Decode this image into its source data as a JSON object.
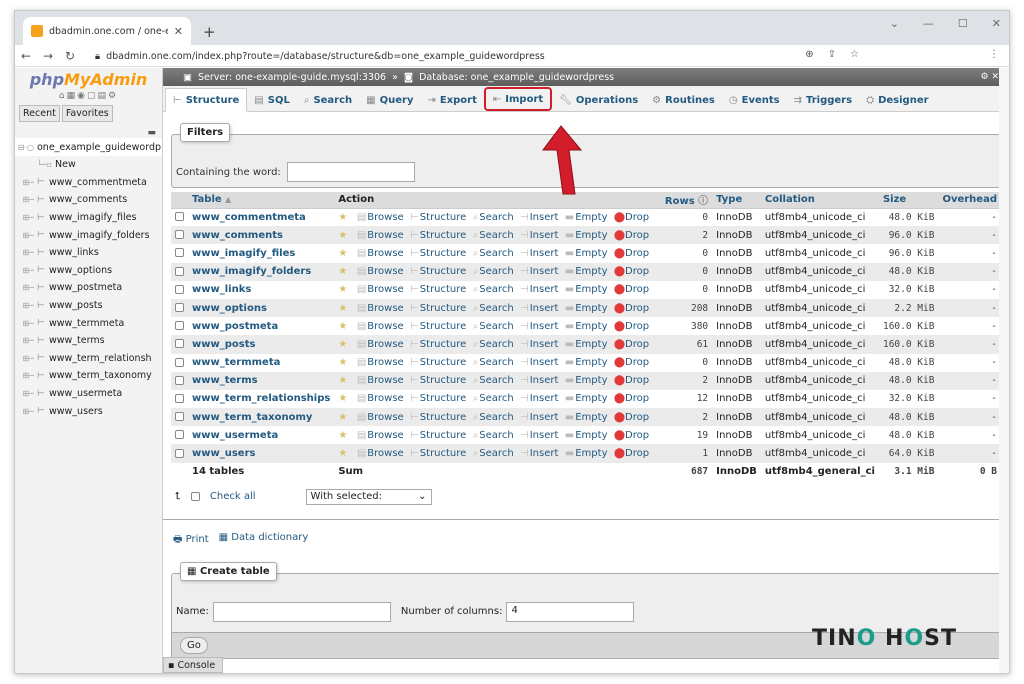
{
  "browser": {
    "tab_title": "dbadmin.one.com / one-exampl",
    "url": "dbadmin.one.com/index.php?route=/database/structure&db=one_example_guidewordpress"
  },
  "logo": {
    "a": "php",
    "b": "MyAdmin"
  },
  "nav": {
    "recent": "Recent",
    "favorites": "Favorites",
    "db": "one_example_guidewordp",
    "new": "New",
    "tables": [
      "www_commentmeta",
      "www_comments",
      "www_imagify_files",
      "www_imagify_folders",
      "www_links",
      "www_options",
      "www_postmeta",
      "www_posts",
      "www_termmeta",
      "www_terms",
      "www_term_relationsh",
      "www_term_taxonomy",
      "www_usermeta",
      "www_users"
    ]
  },
  "breadcrumb": {
    "server": "Server: one-example-guide.mysql:3306",
    "sep": "»",
    "database": "Database: one_example_guidewordpress"
  },
  "menu": [
    "Structure",
    "SQL",
    "Search",
    "Query",
    "Export",
    "Import",
    "Operations",
    "Routines",
    "Events",
    "Triggers",
    "Designer"
  ],
  "filters": {
    "legend": "Filters",
    "label": "Containing the word:"
  },
  "table": {
    "headers": {
      "table": "Table",
      "action": "Action",
      "rows": "Rows",
      "type": "Type",
      "collation": "Collation",
      "size": "Size",
      "overhead": "Overhead"
    },
    "actions": {
      "browse": "Browse",
      "structure": "Structure",
      "search": "Search",
      "insert": "Insert",
      "empty": "Empty",
      "drop": "Drop"
    },
    "rows": [
      {
        "name": "www_commentmeta",
        "rows": "0",
        "type": "InnoDB",
        "coll": "utf8mb4_unicode_ci",
        "size": "48.0 KiB",
        "over": "-"
      },
      {
        "name": "www_comments",
        "rows": "2",
        "type": "InnoDB",
        "coll": "utf8mb4_unicode_ci",
        "size": "96.0 KiB",
        "over": "-"
      },
      {
        "name": "www_imagify_files",
        "rows": "0",
        "type": "InnoDB",
        "coll": "utf8mb4_unicode_ci",
        "size": "96.0 KiB",
        "over": "-"
      },
      {
        "name": "www_imagify_folders",
        "rows": "0",
        "type": "InnoDB",
        "coll": "utf8mb4_unicode_ci",
        "size": "48.0 KiB",
        "over": "-"
      },
      {
        "name": "www_links",
        "rows": "0",
        "type": "InnoDB",
        "coll": "utf8mb4_unicode_ci",
        "size": "32.0 KiB",
        "over": "-"
      },
      {
        "name": "www_options",
        "rows": "208",
        "type": "InnoDB",
        "coll": "utf8mb4_unicode_ci",
        "size": "2.2 MiB",
        "over": "-"
      },
      {
        "name": "www_postmeta",
        "rows": "380",
        "type": "InnoDB",
        "coll": "utf8mb4_unicode_ci",
        "size": "160.0 KiB",
        "over": "-"
      },
      {
        "name": "www_posts",
        "rows": "61",
        "type": "InnoDB",
        "coll": "utf8mb4_unicode_ci",
        "size": "160.0 KiB",
        "over": "-"
      },
      {
        "name": "www_termmeta",
        "rows": "0",
        "type": "InnoDB",
        "coll": "utf8mb4_unicode_ci",
        "size": "48.0 KiB",
        "over": "-"
      },
      {
        "name": "www_terms",
        "rows": "2",
        "type": "InnoDB",
        "coll": "utf8mb4_unicode_ci",
        "size": "48.0 KiB",
        "over": "-"
      },
      {
        "name": "www_term_relationships",
        "rows": "12",
        "type": "InnoDB",
        "coll": "utf8mb4_unicode_ci",
        "size": "32.0 KiB",
        "over": "-"
      },
      {
        "name": "www_term_taxonomy",
        "rows": "2",
        "type": "InnoDB",
        "coll": "utf8mb4_unicode_ci",
        "size": "48.0 KiB",
        "over": "-"
      },
      {
        "name": "www_usermeta",
        "rows": "19",
        "type": "InnoDB",
        "coll": "utf8mb4_unicode_ci",
        "size": "48.0 KiB",
        "over": "-"
      },
      {
        "name": "www_users",
        "rows": "1",
        "type": "InnoDB",
        "coll": "utf8mb4_unicode_ci",
        "size": "64.0 KiB",
        "over": "-"
      }
    ],
    "sum": {
      "label": "14 tables",
      "sum": "Sum",
      "rows": "687",
      "type": "InnoDB",
      "coll": "utf8mb4_general_ci",
      "size": "3.1 MiB",
      "over": "0 B"
    }
  },
  "bulk": {
    "check_all": "Check all",
    "with_selected": "With selected:"
  },
  "links": {
    "print": "Print",
    "dict": "Data dictionary"
  },
  "create": {
    "legend": "Create table",
    "name_label": "Name:",
    "cols_label": "Number of columns:",
    "cols_value": "4",
    "go": "Go"
  },
  "console": "Console",
  "watermark": {
    "a": "TIN",
    "o": "O",
    "b": "H",
    "o2": "O",
    "c": "ST"
  }
}
